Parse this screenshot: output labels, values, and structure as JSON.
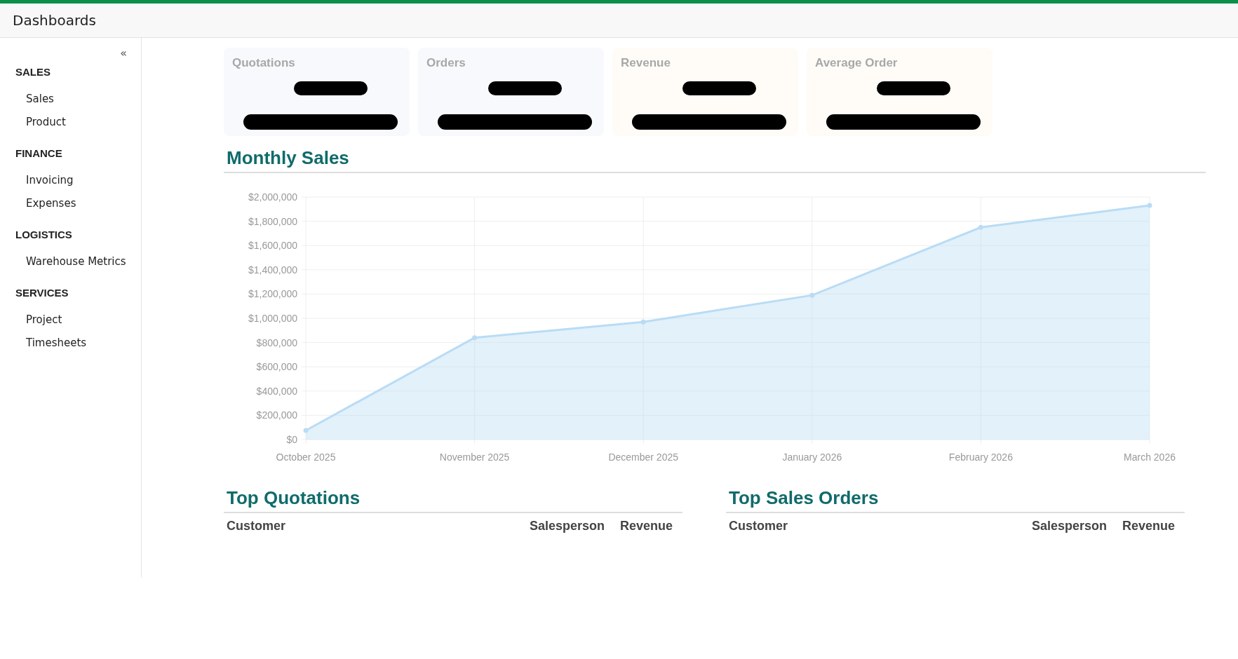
{
  "header": {
    "title": "Dashboards"
  },
  "sidebar": {
    "collapse_icon": "«",
    "sections": [
      {
        "heading": "SALES",
        "items": [
          "Sales",
          "Product"
        ]
      },
      {
        "heading": "FINANCE",
        "items": [
          "Invoicing",
          "Expenses"
        ]
      },
      {
        "heading": "LOGISTICS",
        "items": [
          "Warehouse Metrics"
        ]
      },
      {
        "heading": "SERVICES",
        "items": [
          "Project",
          "Timesheets"
        ]
      }
    ]
  },
  "kpi_cards": [
    {
      "title": "Quotations",
      "color": "#f8f9fc"
    },
    {
      "title": "Orders",
      "color": "#f8f9fc"
    },
    {
      "title": "Revenue",
      "color": "#fffcf8"
    },
    {
      "title": "Average Order",
      "color": "#fffcf8"
    }
  ],
  "monthly_sales": {
    "title": "Monthly Sales",
    "chart_data": {
      "type": "area",
      "categories": [
        "October 2025",
        "November 2025",
        "December 2025",
        "January 2026",
        "February 2026",
        "March 2026"
      ],
      "series": [
        {
          "color": "#b9dcf5",
          "values": [
            75000,
            840000,
            970000,
            1190000,
            1750000,
            1930000
          ]
        }
      ],
      "grid": true,
      "ylim": [
        0,
        2000000
      ],
      "yticks": [
        {
          "value": 0,
          "label": "$0"
        },
        {
          "value": 200000,
          "label": "$200,000"
        },
        {
          "value": 400000,
          "label": "$400,000"
        },
        {
          "value": 600000,
          "label": "$600,000"
        },
        {
          "value": 800000,
          "label": "$800,000"
        },
        {
          "value": 1000000,
          "label": "$1,000,000"
        },
        {
          "value": 1200000,
          "label": "$1,200,000"
        },
        {
          "value": 1400000,
          "label": "$1,400,000"
        },
        {
          "value": 1600000,
          "label": "$1,600,000"
        },
        {
          "value": 1800000,
          "label": "$1,800,000"
        },
        {
          "value": 2000000,
          "label": "$2,000,000"
        }
      ]
    }
  },
  "tables": [
    {
      "title": "Top Quotations",
      "columns": [
        "Customer",
        "Salesperson",
        "Revenue"
      ]
    },
    {
      "title": "Top Sales Orders",
      "columns": [
        "Customer",
        "Salesperson",
        "Revenue"
      ]
    }
  ]
}
